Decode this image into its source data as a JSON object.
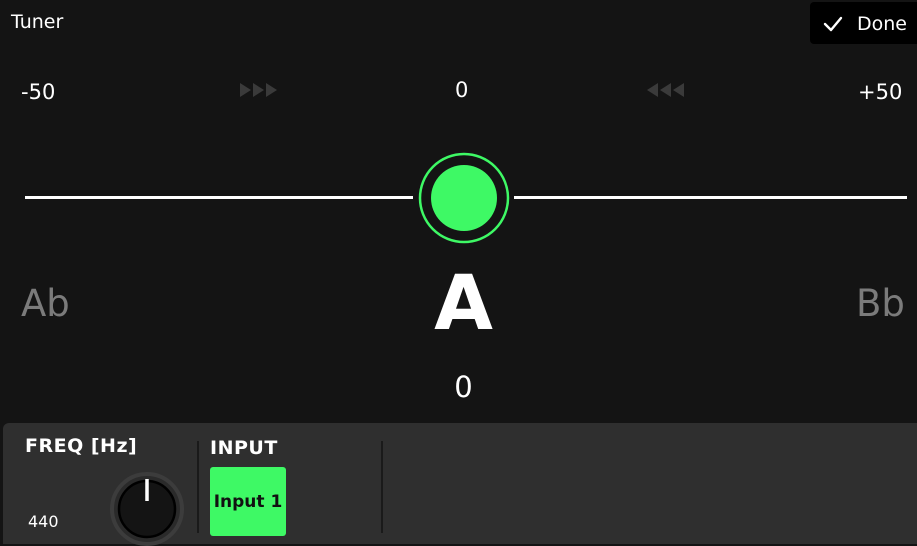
{
  "header": {
    "title": "Tuner",
    "done_label": "Done"
  },
  "scale": {
    "min_label": "-50",
    "center_label": "0",
    "max_label": "+50"
  },
  "tuning": {
    "prev_note": "Ab",
    "current_note": "A",
    "next_note": "Bb",
    "cents": "0",
    "in_tune": true
  },
  "panel": {
    "freq": {
      "heading": "FREQ [Hz]",
      "value": "440"
    },
    "input": {
      "heading": "INPUT",
      "selected": "Input 1"
    }
  },
  "colors": {
    "accent": "#3ef965",
    "background": "#141414",
    "panel": "#2f2f2f",
    "muted_text": "#7b7b7b",
    "arrow": "#3a3a3a"
  },
  "icons": {
    "done": "check-icon",
    "sharp_hint": "triple-arrow-right-icon",
    "flat_hint": "triple-arrow-left-icon",
    "pitch": "pitch-indicator-icon",
    "freq_knob": "knob-icon"
  }
}
